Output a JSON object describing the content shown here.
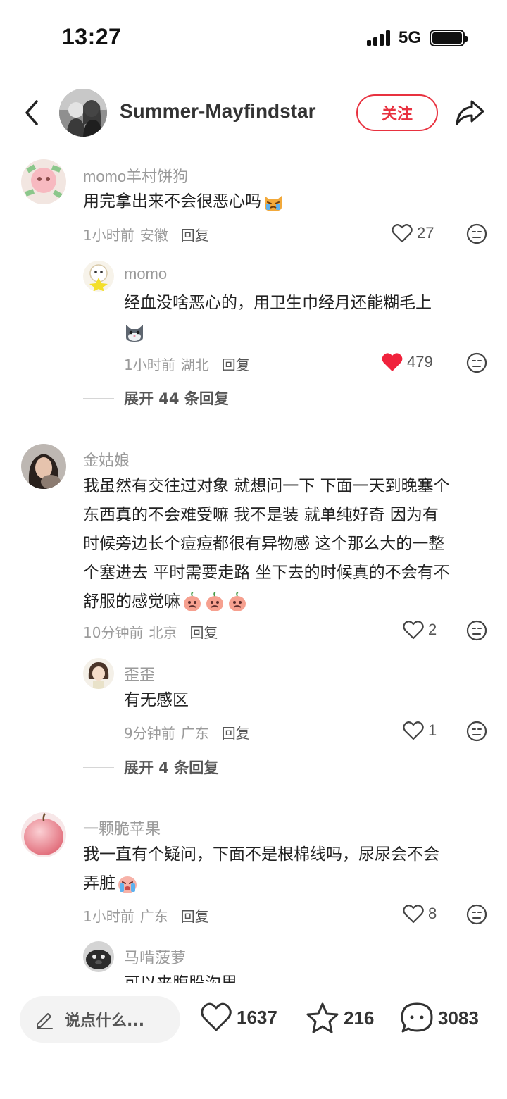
{
  "status_bar": {
    "time": "13:27",
    "network": "5G"
  },
  "header": {
    "username": "Summer-Mayfindstar",
    "follow_label": "关注"
  },
  "colors": {
    "accent": "#e8313f",
    "muted": "#9a9a9a",
    "like_active": "#f0223c"
  },
  "comments": [
    {
      "user": "momo羊村饼狗",
      "text": "用完拿出来不会很恶心吗",
      "emoji": "cat-crying",
      "time": "1小时前",
      "location": "安徽",
      "reply_label": "回复",
      "likes": "27",
      "replies": [
        {
          "user": "momo",
          "text_line1": "经血没啥恶心的，用卫生巾经月还能糊毛上",
          "emoji": "cat-face",
          "time": "1小时前",
          "location": "湖北",
          "reply_label": "回复",
          "likes": "479",
          "liked": true
        }
      ],
      "expand_label": "展开 44 条回复"
    },
    {
      "user": "金姑娘",
      "lines": [
        "我虽然有交往过对象 就想问一下 下面一天到晚塞个",
        "东西真的不会难受嘛 我不是装 就单纯好奇 因为有",
        "时候旁边长个痘痘都很有异物感 这个那么大的一整",
        "个塞进去 平时需要走路 坐下去的时候真的不会有不",
        "舒服的感觉嘛"
      ],
      "emoji": "peach-face",
      "time": "10分钟前",
      "location": "北京",
      "reply_label": "回复",
      "likes": "2",
      "replies": [
        {
          "user": "歪歪",
          "text": "有无感区",
          "time": "9分钟前",
          "location": "广东",
          "reply_label": "回复",
          "likes": "1"
        }
      ],
      "expand_label": "展开 4 条回复"
    },
    {
      "user": "一颗脆苹果",
      "lines": [
        "我一直有个疑问，下面不是根棉线吗，尿尿会不会",
        "弄脏"
      ],
      "emoji": "crying-face",
      "time": "1小时前",
      "location": "广东",
      "reply_label": "回复",
      "likes": "8",
      "replies": [
        {
          "user": "马啃菠萝",
          "text": "可以夹腹股沟里"
        }
      ]
    }
  ],
  "bottom_bar": {
    "input_placeholder": "说点什么...",
    "likes": "1637",
    "favorites": "216",
    "comments": "3083"
  }
}
